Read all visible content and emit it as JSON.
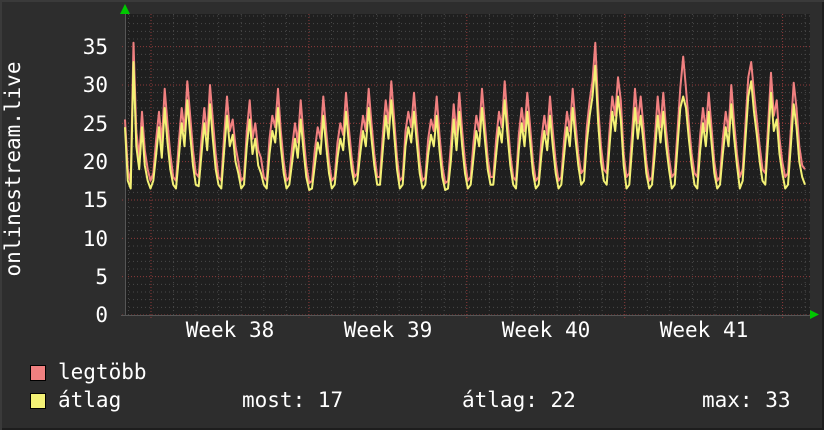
{
  "vertical_label": "onlinestream.live",
  "legend": {
    "items": [
      {
        "label": "legtöbb",
        "color": "#f08080"
      },
      {
        "label": "átlag",
        "color": "#f3f175"
      }
    ]
  },
  "stats": {
    "most": "most: 17",
    "atlag": "átlag: 22",
    "max": "max: 33"
  },
  "colors": {
    "page_bg": "#2d2d2d",
    "plot_bg": "#1f1f1f",
    "grid_minor": "#4a4a4a",
    "grid_major": "#8f3a3a",
    "axis": "#565656",
    "arrow": "#00c800",
    "text": "#ffffff"
  },
  "chart_data": {
    "type": "line",
    "title": "",
    "ylabel": "",
    "xlabel": "",
    "grid": true,
    "legend_position": "bottom-left",
    "y_axis": {
      "tick_labels": [
        "0",
        "5",
        "10",
        "15",
        "20",
        "25",
        "30",
        "35"
      ],
      "ticks": [
        0,
        5,
        10,
        15,
        20,
        25,
        30,
        35
      ],
      "minor_step": 1,
      "major_step": 5,
      "range": [
        0,
        39.3
      ]
    },
    "x_axis": {
      "week_labels": [
        "Week 38",
        "Week 39",
        "Week 40",
        "Week 41"
      ],
      "minor_unit": "day",
      "major_unit": "week",
      "days_shown": 30
    },
    "stats": {
      "most": 17,
      "atlag": 22,
      "max": 33
    },
    "series": [
      {
        "name": "legtöbb",
        "color": "#f08080",
        "values": [
          25.5,
          19,
          17.2,
          35.5,
          24,
          20.5,
          26.5,
          21.5,
          19,
          17.5,
          18.5,
          23,
          26.5,
          22.5,
          29.5,
          25,
          21,
          18,
          17.5,
          22.5,
          27,
          24,
          30.5,
          26,
          21.5,
          18.5,
          18,
          23,
          27,
          23.5,
          30,
          25.5,
          21,
          18,
          17.5,
          23.5,
          28.5,
          24,
          25.5,
          22,
          20,
          17.5,
          18,
          24,
          28,
          23,
          25,
          21.5,
          20.5,
          18,
          17.5,
          23,
          26,
          24.5,
          29.5,
          24,
          20,
          17.5,
          18,
          22,
          25,
          22.5,
          28,
          23.5,
          19.5,
          17.2,
          17.5,
          21.5,
          24.5,
          23,
          28.5,
          24,
          20,
          17.5,
          18,
          22.5,
          25,
          23.5,
          29,
          24.5,
          20.5,
          18,
          18.5,
          23,
          26,
          24,
          29.5,
          25,
          21,
          18,
          18,
          23.5,
          28,
          25,
          30.5,
          25.5,
          20.5,
          17.5,
          18,
          24,
          26.5,
          24.5,
          29,
          24.5,
          20,
          17.5,
          18,
          23,
          25.5,
          24,
          28.5,
          23.5,
          19.5,
          17.2,
          17.5,
          22,
          27.5,
          23.5,
          29,
          24,
          20,
          17.5,
          18,
          22.5,
          26,
          24,
          29.5,
          25,
          20.5,
          18,
          18,
          23,
          26.5,
          24.5,
          30.5,
          25.5,
          21,
          18,
          17.5,
          23.5,
          27,
          24,
          29,
          24.5,
          20,
          17.5,
          18,
          23,
          26,
          23.5,
          28.5,
          24,
          20,
          17.5,
          18,
          23,
          26.5,
          24,
          29.5,
          25,
          21,
          18.5,
          19,
          24.5,
          28,
          30.5,
          35.5,
          27,
          22,
          19,
          18.5,
          24,
          28.5,
          26,
          31,
          28,
          21,
          18,
          18.5,
          24,
          29.5,
          25,
          28.5,
          24.5,
          20,
          17.5,
          18,
          23,
          28.5,
          24.5,
          29,
          24,
          20.5,
          18,
          18.5,
          24,
          29.6,
          33.7,
          29.5,
          25,
          21,
          18.5,
          18,
          23.5,
          27,
          24,
          29,
          24.5,
          20,
          17.5,
          18,
          23,
          26.5,
          24,
          30,
          25,
          21,
          18,
          19,
          25,
          31,
          33,
          29,
          25.5,
          22,
          19,
          18.5,
          25,
          31.6,
          26,
          28,
          23,
          20,
          18,
          18.5,
          24,
          30.3,
          27,
          22,
          19.5,
          19
        ]
      },
      {
        "name": "átlag",
        "color": "#f3f175",
        "values": [
          24.5,
          17.5,
          16.5,
          33,
          22,
          19,
          24.5,
          19.5,
          17.5,
          16.5,
          17.5,
          21,
          24.5,
          20.5,
          27,
          22.5,
          19,
          17,
          16.5,
          20.5,
          25,
          22,
          28,
          23.5,
          19.5,
          17,
          16.8,
          21,
          25,
          21.5,
          27.5,
          23,
          19,
          17,
          16.5,
          21.5,
          26,
          22,
          23.5,
          20,
          18.5,
          16.5,
          17,
          22,
          25.5,
          21,
          23,
          19.5,
          18.5,
          17,
          16.5,
          21,
          24,
          22.5,
          27,
          22,
          18.5,
          16.5,
          17,
          20,
          23,
          20.5,
          25.5,
          21.5,
          18,
          16.3,
          16.5,
          19.5,
          22.5,
          21,
          26,
          22,
          18.5,
          16.5,
          17,
          20.5,
          23,
          21.5,
          26.5,
          22.5,
          19,
          17,
          17.5,
          21,
          24,
          22,
          27,
          23,
          19.5,
          17,
          17,
          21.5,
          26,
          23,
          28,
          23.5,
          19,
          16.5,
          17,
          22,
          24.5,
          22.5,
          26.5,
          22.5,
          18.5,
          16.5,
          17,
          21,
          23.5,
          22,
          26,
          21.5,
          18,
          16.3,
          16.5,
          20,
          25.5,
          21.5,
          26.5,
          22,
          18.5,
          16.5,
          17,
          20.5,
          24,
          22,
          27,
          23,
          19,
          17,
          17,
          21,
          24.5,
          22.5,
          28,
          23.5,
          19.5,
          17,
          16.5,
          21.5,
          25,
          22,
          26.5,
          22.5,
          18.5,
          16.5,
          17,
          21,
          24,
          21.5,
          26,
          22,
          18.5,
          16.5,
          17,
          21,
          24.5,
          22,
          27,
          23,
          19.5,
          17,
          17.5,
          22.5,
          26,
          28.5,
          32.5,
          25,
          20,
          17.5,
          17,
          22,
          26.5,
          24,
          28.5,
          25.5,
          19.5,
          16.5,
          17,
          22,
          27,
          23,
          26,
          22.5,
          18.5,
          16.5,
          17,
          21,
          26,
          22.5,
          26.5,
          22,
          19,
          16.5,
          17,
          22,
          27,
          28.5,
          27,
          23,
          19.5,
          17,
          16.5,
          21.5,
          25,
          22,
          26.5,
          22.5,
          18.5,
          16.5,
          17,
          21,
          24.5,
          22,
          27.5,
          23,
          19.5,
          16.5,
          17.5,
          23,
          28.5,
          30.5,
          26.5,
          23.5,
          20,
          17.5,
          17,
          23,
          29,
          24,
          25.5,
          21,
          18.5,
          16.5,
          17,
          22,
          27.5,
          24.5,
          20,
          18,
          17
        ]
      }
    ]
  }
}
